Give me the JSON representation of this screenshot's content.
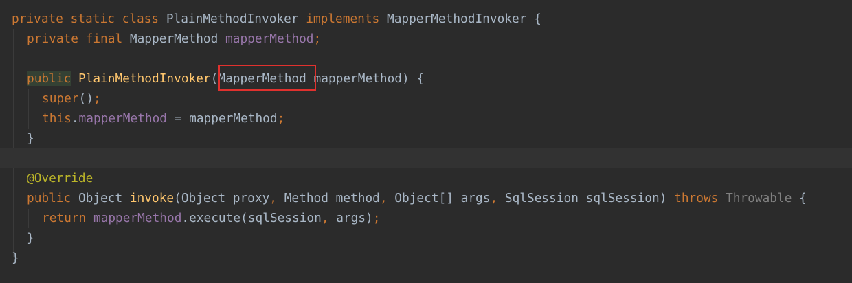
{
  "lines": {
    "l1": {
      "t1": "private",
      "t2": " static",
      "t3": " class",
      "t4": " PlainMethodInvoker",
      "t5": " implements",
      "t6": " MapperMethodInvoker",
      "t7": " {"
    },
    "l2": {
      "t1": "private",
      "t2": " final",
      "t3": " MapperMethod",
      "t4": " mapperMethod",
      "t5": ";"
    },
    "l4": {
      "t1": "public",
      "t2": " PlainMethodInvoker",
      "t3": "(",
      "t4": "MapperMethod",
      "t5": " mapperMethod)",
      "t6": " {"
    },
    "l5": {
      "t1": "super",
      "t2": "()",
      "t3": ";"
    },
    "l6": {
      "t1": "this",
      "t2": ".",
      "t3": "mapperMethod",
      "t4": " = mapperMethod",
      "t5": ";"
    },
    "l7": {
      "t1": "}"
    },
    "l9": {
      "t1": "@Override"
    },
    "l10": {
      "t1": "public",
      "t2": " Object",
      "t3": " invoke",
      "t4": "(Object proxy",
      "t5": ",",
      "t6": " Method method",
      "t7": ",",
      "t8": " Object[] args",
      "t9": ",",
      "t10": " SqlSession sqlSession)",
      "t11": " throws",
      "t12": " Throwable",
      "t13": " {"
    },
    "l11": {
      "t1": "return",
      "t2": " mapperMethod",
      "t3": ".execute(sqlSession",
      "t4": ",",
      "t5": " args)",
      "t6": ";"
    },
    "l12": {
      "t1": "}"
    },
    "l13": {
      "t1": "}"
    }
  },
  "colors": {
    "background": "#2b2b2b",
    "keyword": "#cc7832",
    "identifier": "#a9b7c6",
    "method_decl": "#ffc66d",
    "field": "#9876aa",
    "annotation": "#bbb529",
    "highlight_border": "#e0312e"
  }
}
